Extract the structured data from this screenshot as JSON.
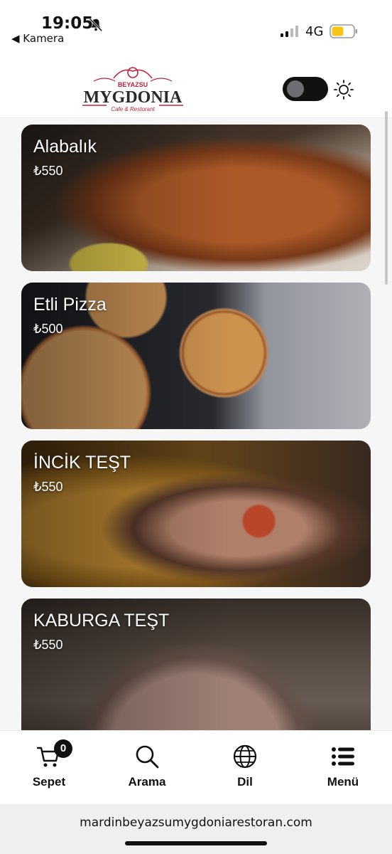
{
  "status": {
    "time": "19:05",
    "back_label": "◀ Kamera",
    "network": "4G"
  },
  "header": {
    "logo_top": "BEYAZSU",
    "logo_main": "MYGDONIA",
    "logo_sub": "Cafe & Restorant"
  },
  "menu_items": [
    {
      "name": "Alabalık",
      "price": "₺550"
    },
    {
      "name": "Etli Pizza",
      "price": "₺500"
    },
    {
      "name": "İNCİK TEŞT",
      "price": "₺550"
    },
    {
      "name": "KABURGA TEŞT",
      "price": "₺550"
    }
  ],
  "nav": {
    "cart_label": "Sepet",
    "cart_count": "0",
    "search_label": "Arama",
    "language_label": "Dil",
    "menu_label": "Menü"
  },
  "browser": {
    "url": "mardinbeyazsumygdoniarestoran.com"
  }
}
